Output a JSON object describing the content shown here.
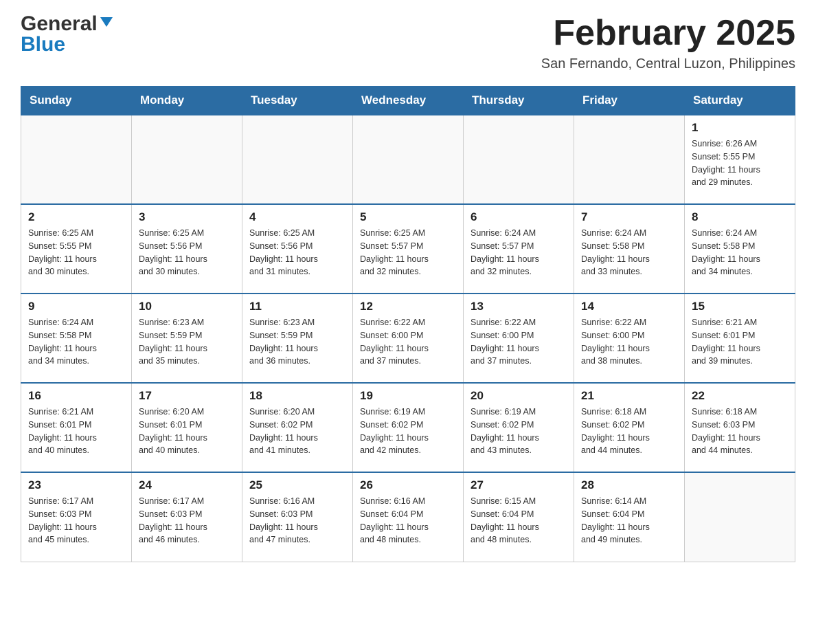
{
  "header": {
    "logo_general": "General",
    "logo_blue": "Blue",
    "month_title": "February 2025",
    "location": "San Fernando, Central Luzon, Philippines"
  },
  "days_of_week": [
    "Sunday",
    "Monday",
    "Tuesday",
    "Wednesday",
    "Thursday",
    "Friday",
    "Saturday"
  ],
  "weeks": [
    {
      "days": [
        {
          "date": "",
          "info": ""
        },
        {
          "date": "",
          "info": ""
        },
        {
          "date": "",
          "info": ""
        },
        {
          "date": "",
          "info": ""
        },
        {
          "date": "",
          "info": ""
        },
        {
          "date": "",
          "info": ""
        },
        {
          "date": "1",
          "info": "Sunrise: 6:26 AM\nSunset: 5:55 PM\nDaylight: 11 hours\nand 29 minutes."
        }
      ]
    },
    {
      "days": [
        {
          "date": "2",
          "info": "Sunrise: 6:25 AM\nSunset: 5:55 PM\nDaylight: 11 hours\nand 30 minutes."
        },
        {
          "date": "3",
          "info": "Sunrise: 6:25 AM\nSunset: 5:56 PM\nDaylight: 11 hours\nand 30 minutes."
        },
        {
          "date": "4",
          "info": "Sunrise: 6:25 AM\nSunset: 5:56 PM\nDaylight: 11 hours\nand 31 minutes."
        },
        {
          "date": "5",
          "info": "Sunrise: 6:25 AM\nSunset: 5:57 PM\nDaylight: 11 hours\nand 32 minutes."
        },
        {
          "date": "6",
          "info": "Sunrise: 6:24 AM\nSunset: 5:57 PM\nDaylight: 11 hours\nand 32 minutes."
        },
        {
          "date": "7",
          "info": "Sunrise: 6:24 AM\nSunset: 5:58 PM\nDaylight: 11 hours\nand 33 minutes."
        },
        {
          "date": "8",
          "info": "Sunrise: 6:24 AM\nSunset: 5:58 PM\nDaylight: 11 hours\nand 34 minutes."
        }
      ]
    },
    {
      "days": [
        {
          "date": "9",
          "info": "Sunrise: 6:24 AM\nSunset: 5:58 PM\nDaylight: 11 hours\nand 34 minutes."
        },
        {
          "date": "10",
          "info": "Sunrise: 6:23 AM\nSunset: 5:59 PM\nDaylight: 11 hours\nand 35 minutes."
        },
        {
          "date": "11",
          "info": "Sunrise: 6:23 AM\nSunset: 5:59 PM\nDaylight: 11 hours\nand 36 minutes."
        },
        {
          "date": "12",
          "info": "Sunrise: 6:22 AM\nSunset: 6:00 PM\nDaylight: 11 hours\nand 37 minutes."
        },
        {
          "date": "13",
          "info": "Sunrise: 6:22 AM\nSunset: 6:00 PM\nDaylight: 11 hours\nand 37 minutes."
        },
        {
          "date": "14",
          "info": "Sunrise: 6:22 AM\nSunset: 6:00 PM\nDaylight: 11 hours\nand 38 minutes."
        },
        {
          "date": "15",
          "info": "Sunrise: 6:21 AM\nSunset: 6:01 PM\nDaylight: 11 hours\nand 39 minutes."
        }
      ]
    },
    {
      "days": [
        {
          "date": "16",
          "info": "Sunrise: 6:21 AM\nSunset: 6:01 PM\nDaylight: 11 hours\nand 40 minutes."
        },
        {
          "date": "17",
          "info": "Sunrise: 6:20 AM\nSunset: 6:01 PM\nDaylight: 11 hours\nand 40 minutes."
        },
        {
          "date": "18",
          "info": "Sunrise: 6:20 AM\nSunset: 6:02 PM\nDaylight: 11 hours\nand 41 minutes."
        },
        {
          "date": "19",
          "info": "Sunrise: 6:19 AM\nSunset: 6:02 PM\nDaylight: 11 hours\nand 42 minutes."
        },
        {
          "date": "20",
          "info": "Sunrise: 6:19 AM\nSunset: 6:02 PM\nDaylight: 11 hours\nand 43 minutes."
        },
        {
          "date": "21",
          "info": "Sunrise: 6:18 AM\nSunset: 6:02 PM\nDaylight: 11 hours\nand 44 minutes."
        },
        {
          "date": "22",
          "info": "Sunrise: 6:18 AM\nSunset: 6:03 PM\nDaylight: 11 hours\nand 44 minutes."
        }
      ]
    },
    {
      "days": [
        {
          "date": "23",
          "info": "Sunrise: 6:17 AM\nSunset: 6:03 PM\nDaylight: 11 hours\nand 45 minutes."
        },
        {
          "date": "24",
          "info": "Sunrise: 6:17 AM\nSunset: 6:03 PM\nDaylight: 11 hours\nand 46 minutes."
        },
        {
          "date": "25",
          "info": "Sunrise: 6:16 AM\nSunset: 6:03 PM\nDaylight: 11 hours\nand 47 minutes."
        },
        {
          "date": "26",
          "info": "Sunrise: 6:16 AM\nSunset: 6:04 PM\nDaylight: 11 hours\nand 48 minutes."
        },
        {
          "date": "27",
          "info": "Sunrise: 6:15 AM\nSunset: 6:04 PM\nDaylight: 11 hours\nand 48 minutes."
        },
        {
          "date": "28",
          "info": "Sunrise: 6:14 AM\nSunset: 6:04 PM\nDaylight: 11 hours\nand 49 minutes."
        },
        {
          "date": "",
          "info": ""
        }
      ]
    }
  ]
}
